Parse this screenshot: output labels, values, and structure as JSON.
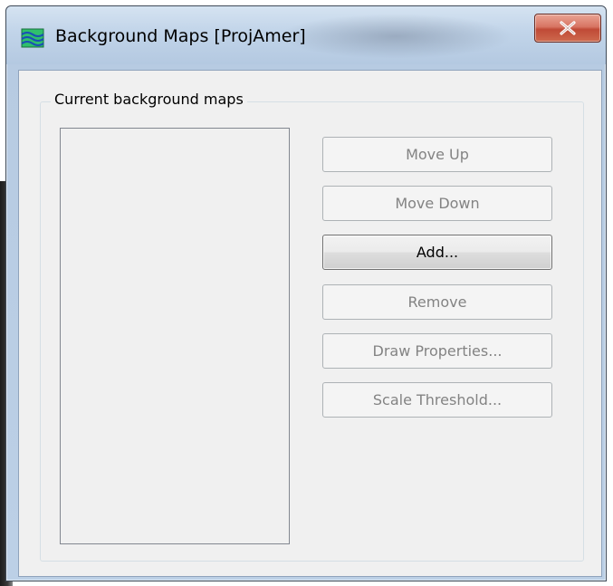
{
  "window": {
    "title": "Background Maps [ProjAmer]",
    "icon": "map-layers-icon",
    "close_glyph": "x"
  },
  "group": {
    "label": "Current background maps"
  },
  "map_list": {
    "items": []
  },
  "buttons": {
    "move_up": {
      "label": "Move Up",
      "enabled": false
    },
    "move_down": {
      "label": "Move Down",
      "enabled": false
    },
    "add": {
      "label": "Add...",
      "enabled": true
    },
    "remove": {
      "label": "Remove",
      "enabled": false
    },
    "draw_properties": {
      "label": "Draw Properties...",
      "enabled": false
    },
    "scale_threshold": {
      "label": "Scale Threshold...",
      "enabled": false
    }
  },
  "colors": {
    "close_button": "#c04a36",
    "disabled_text": "#838383",
    "dialog_background": "#f0f0f0"
  }
}
